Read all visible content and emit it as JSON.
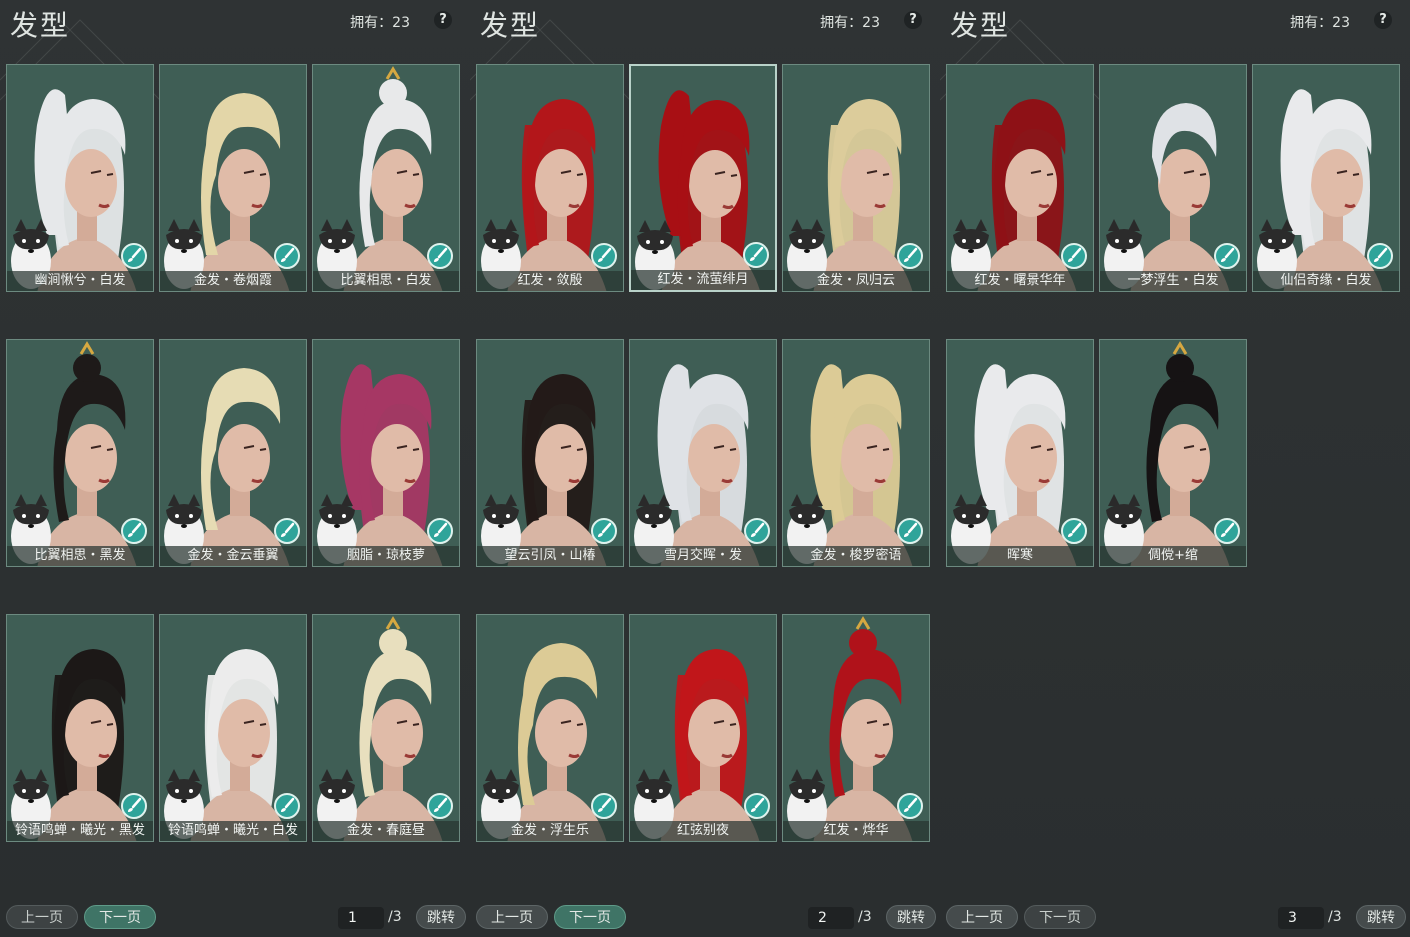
{
  "panels": [
    {
      "title": "发型",
      "owned": "拥有：23",
      "help": "?",
      "prev": "上一页",
      "next": "下一页",
      "page": "1",
      "total": "/3",
      "jump": "跳转",
      "prev_enabled": false,
      "next_enabled": true,
      "items": [
        {
          "label": "幽涧愀兮・白发",
          "hair": "#e6e8ea",
          "style": "pony"
        },
        {
          "label": "金发・卷烟霞",
          "hair": "#e3d6a8",
          "style": "curl"
        },
        {
          "label": "比翼相思・白发",
          "hair": "#e8e9ea",
          "style": "bun"
        },
        {
          "label": "比翼相思・黑发",
          "hair": "#1e1a19",
          "style": "bun"
        },
        {
          "label": "金发・金云垂翼",
          "hair": "#e6dcb4",
          "style": "curl"
        },
        {
          "label": "胭脂・琼枝萝",
          "hair": "#a63764",
          "style": "pony"
        },
        {
          "label": "铃语鸣蝉・曦光・黑发",
          "hair": "#1c1817",
          "style": "long"
        },
        {
          "label": "铃语鸣蝉・曦光・白发",
          "hair": "#ececec",
          "style": "long"
        },
        {
          "label": "金发・春庭昼",
          "hair": "#e8dfbe",
          "style": "bun"
        }
      ]
    },
    {
      "title": "发型",
      "owned": "拥有：23",
      "help": "?",
      "prev": "上一页",
      "next": "下一页",
      "page": "2",
      "total": "/3",
      "jump": "跳转",
      "prev_enabled": true,
      "next_enabled": true,
      "selected_index": 1,
      "items": [
        {
          "label": "红发・敛殷",
          "hair": "#b3161a",
          "style": "long"
        },
        {
          "label": "红发・流萤绯月",
          "hair": "#a80f14",
          "style": "pony"
        },
        {
          "label": "金发・凤归云",
          "hair": "#dccc9b",
          "style": "long"
        },
        {
          "label": "望云引凤・山椿",
          "hair": "#231a18",
          "style": "long"
        },
        {
          "label": "雪月交晖・发",
          "hair": "#dfe2e6",
          "style": "pony"
        },
        {
          "label": "金发・梭罗密语",
          "hair": "#dccb96",
          "style": "pony"
        },
        {
          "label": "金发・浮生乐",
          "hair": "#dccb96",
          "style": "curl"
        },
        {
          "label": "红弦别夜",
          "hair": "#c1161a",
          "style": "long"
        },
        {
          "label": "红发・烨华",
          "hair": "#b0121a",
          "style": "bun"
        }
      ]
    },
    {
      "title": "发型",
      "owned": "拥有：23",
      "help": "?",
      "prev": "上一页",
      "next": "下一页",
      "page": "3",
      "total": "/3",
      "jump": "跳转",
      "prev_enabled": true,
      "next_enabled": false,
      "items": [
        {
          "label": "红发・曙景华年",
          "hair": "#8e1116",
          "style": "long"
        },
        {
          "label": "一梦浮生・白发",
          "hair": "#dfe2e6",
          "style": "short"
        },
        {
          "label": "仙侣奇缘・白发",
          "hair": "#e9eaec",
          "style": "pony"
        },
        {
          "label": "晖寒",
          "hair": "#e9eaec",
          "style": "pony"
        },
        {
          "label": "倜傥+绾",
          "hair": "#161314",
          "style": "bun"
        }
      ]
    }
  ],
  "icons": {
    "dye": "paint-brush-icon",
    "help": "question-mark-icon",
    "pet": "husky-pet-icon"
  }
}
